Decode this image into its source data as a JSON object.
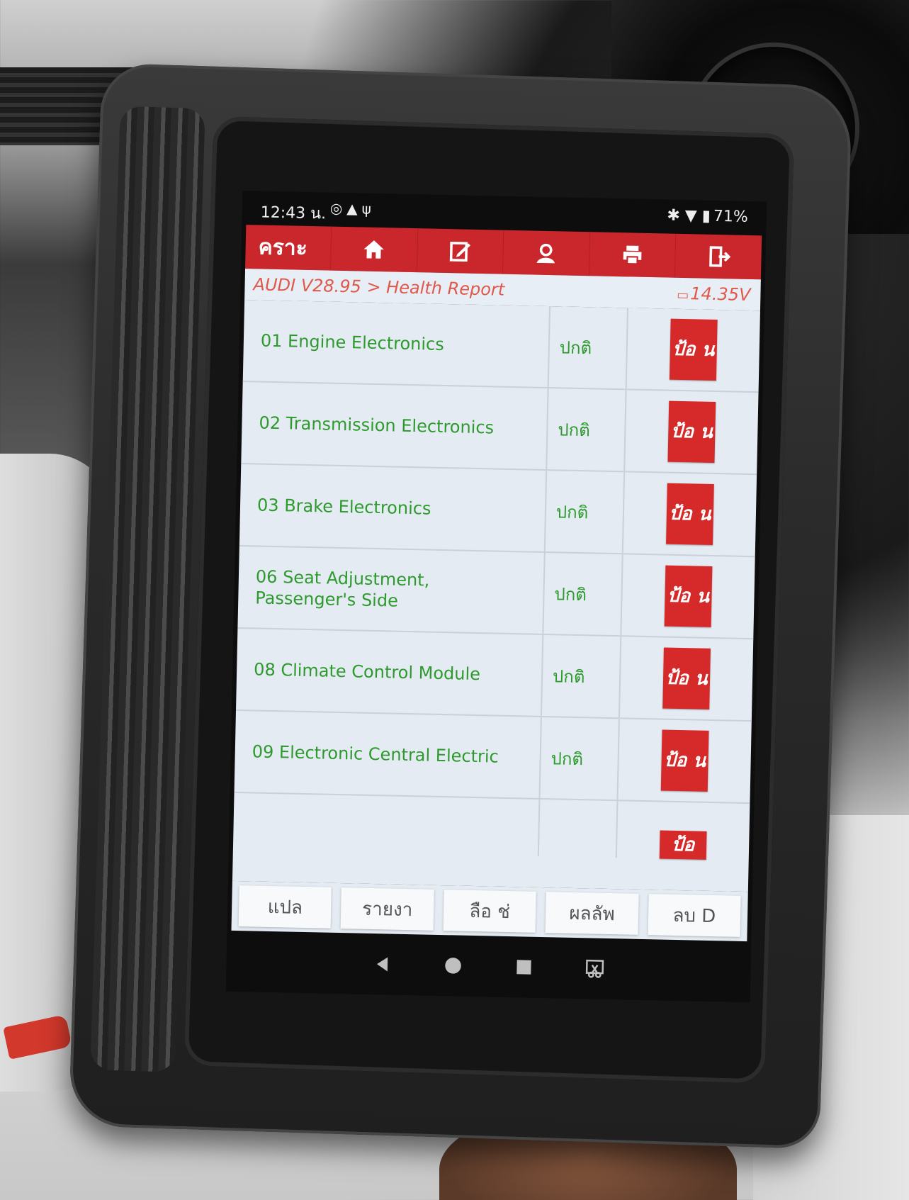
{
  "status_bar": {
    "time": "12:43 น.",
    "left_icons": [
      "sync-icon",
      "warning-icon",
      "usb-icon"
    ],
    "right_icons": [
      "bluetooth-icon",
      "wifi-icon",
      "battery-icon"
    ],
    "battery": "71%"
  },
  "toolbar": {
    "title": "คราะ",
    "buttons": [
      "home-icon",
      "edit-icon",
      "support-icon",
      "print-icon",
      "exit-icon"
    ]
  },
  "breadcrumb": "AUDI V28.95 > Health Report",
  "voltage": "14.35V",
  "rows": [
    {
      "name": "01 Engine Electronics",
      "status": "ปกติ",
      "action": "ป้อ น"
    },
    {
      "name": "02 Transmission Electronics",
      "status": "ปกติ",
      "action": "ป้อ น"
    },
    {
      "name": "03 Brake Electronics",
      "status": "ปกติ",
      "action": "ป้อ น"
    },
    {
      "name": "06 Seat Adjustment, Passenger's Side",
      "status": "ปกติ",
      "action": "ป้อ น"
    },
    {
      "name": "08 Climate Control Module",
      "status": "ปกติ",
      "action": "ป้อ น"
    },
    {
      "name": "09 Electronic Central Electric",
      "status": "ปกติ",
      "action": "ป้อ น"
    }
  ],
  "partial_row_action": "ป้อ",
  "bottom_buttons": [
    "แปล",
    "รายงา",
    "ลือ ช่",
    "ผลลัพ",
    "ลบ D"
  ],
  "nav": [
    "back-icon",
    "home-circle-icon",
    "recents-icon",
    "screenshot-icon"
  ],
  "colors": {
    "toolbar": "#c9272c",
    "text_green": "#2e9a2e",
    "breadcrumb": "#e0584a",
    "code_button": "#d62a2a"
  }
}
